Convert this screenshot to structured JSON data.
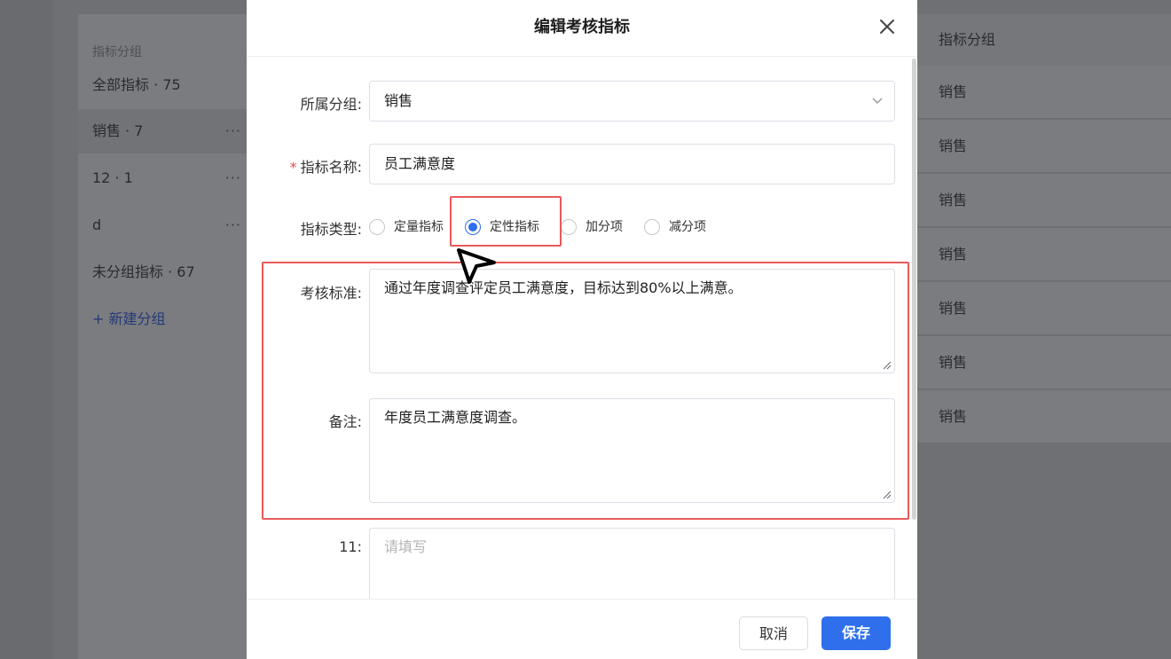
{
  "background": {
    "group_panel": {
      "header": "指标分组",
      "items": [
        {
          "label": "全部指标 · 75",
          "more": ""
        },
        {
          "label": "销售 · 7",
          "more": "···"
        },
        {
          "label": "12 · 1",
          "more": "···"
        },
        {
          "label": "d",
          "more": "···"
        },
        {
          "label": "未分组指标 · 67",
          "more": ""
        }
      ],
      "new_group": "+ 新建分组"
    },
    "table": {
      "header": "指标分组",
      "rows": [
        "销售",
        "销售",
        "销售",
        "销售",
        "销售",
        "销售",
        "销售"
      ]
    }
  },
  "modal": {
    "title": "编辑考核指标",
    "close_icon": "close-icon",
    "group": {
      "label": "所属分组:",
      "value": "销售"
    },
    "name": {
      "required_mark": "*",
      "label": "指标名称:",
      "value": "员工满意度"
    },
    "type": {
      "label": "指标类型:",
      "options": [
        "定量指标",
        "定性指标",
        "加分项",
        "减分项"
      ],
      "selected": "定性指标"
    },
    "criteria": {
      "label": "考核标准:",
      "value": "通过年度调查评定员工满意度，目标达到80%以上满意。"
    },
    "remark": {
      "label": "备注:",
      "value": "年度员工满意度调查。"
    },
    "custom": {
      "label": "11:",
      "placeholder": "请填写"
    },
    "footer": {
      "cancel": "取消",
      "save": "保存"
    }
  },
  "colors": {
    "accent": "#2f6fec",
    "highlight": "#e85a5a",
    "required": "#e34d4d"
  }
}
